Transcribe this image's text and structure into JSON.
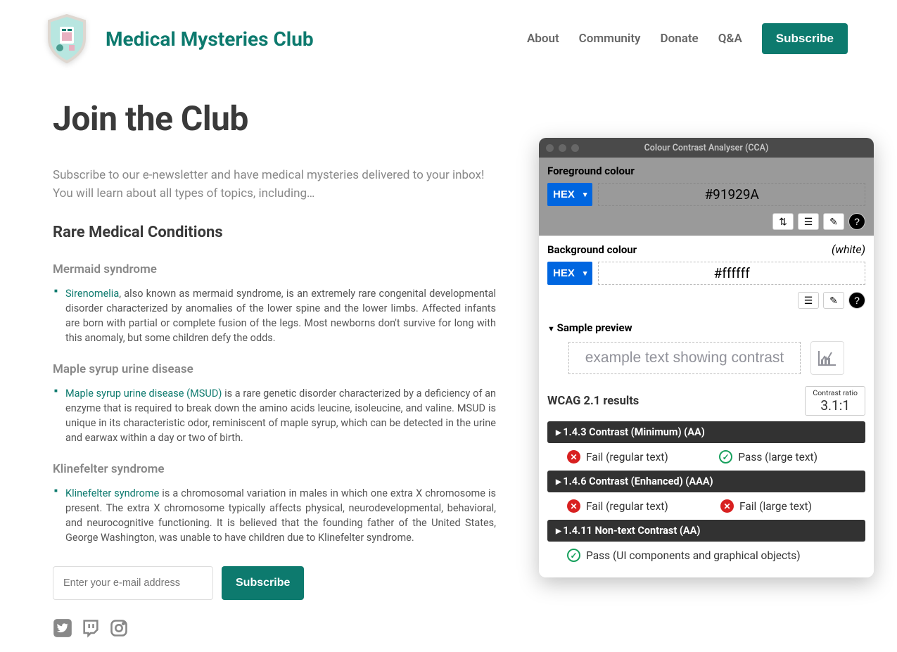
{
  "site": {
    "title": "Medical Mysteries Club"
  },
  "nav": {
    "items": [
      "About",
      "Community",
      "Donate",
      "Q&A"
    ],
    "subscribe": "Subscribe"
  },
  "page": {
    "title": "Join the Club",
    "intro": "Subscribe to our e-newsletter and have medical mysteries delivered to your inbox! You will learn about all types of topics, including…",
    "section_heading": "Rare Medical Conditions"
  },
  "conditions": [
    {
      "name": "Mermaid syndrome",
      "link": "Sirenomelia",
      "body": ", also known as mermaid syndrome, is an extremely rare congenital developmental disorder characterized by anomalies of the lower spine and the lower limbs. Affected infants are born with partial or complete fusion of the legs. Most newborns don't survive for long with this anomaly, but some children defy the odds."
    },
    {
      "name": "Maple syrup urine disease",
      "link": "Maple syrup urine disease (MSUD)",
      "body": " is a rare genetic disorder characterized by a deficiency of an enzyme that is required to break down the amino acids leucine, isoleucine, and valine. MSUD is unique in its characteristic odor, reminiscent of maple syrup, which can be detected in the urine and earwax within a day or two of birth."
    },
    {
      "name": "Klinefelter syndrome",
      "link": "Klinefelter syndrome",
      "body": " is a chromosomal variation in males in which one extra X chromosome is present. The extra X chromosome typically affects physical, neurodevelopmental, behavioral, and neurocognitive functioning. It is believed that the founding father of the United States, George Washington, was unable to have children due to Klinefelter syndrome."
    }
  ],
  "signup": {
    "placeholder": "Enter your e-mail address",
    "button": "Subscribe"
  },
  "cca": {
    "title": "Colour Contrast Analyser (CCA)",
    "fg_label": "Foreground colour",
    "bg_label": "Background colour",
    "hex": "HEX",
    "fg_value": "#91929A",
    "bg_value": "#ffffff",
    "white_note": "(white)",
    "preview_label": "Sample preview",
    "preview_text": "example text showing contrast",
    "results_label": "WCAG 2.1 results",
    "ratio_label": "Contrast ratio",
    "ratio": "3.1:1",
    "criteria": [
      {
        "label": "1.4.3 Contrast (Minimum) (AA)",
        "regular": {
          "pass": false,
          "text": "Fail (regular text)"
        },
        "large": {
          "pass": true,
          "text": "Pass (large text)"
        }
      },
      {
        "label": "1.4.6 Contrast (Enhanced) (AAA)",
        "regular": {
          "pass": false,
          "text": "Fail (regular text)"
        },
        "large": {
          "pass": false,
          "text": "Fail (large text)"
        }
      },
      {
        "label": "1.4.11 Non-text Contrast (AA)",
        "single": {
          "pass": true,
          "text": "Pass (UI components and graphical objects)"
        }
      }
    ]
  }
}
